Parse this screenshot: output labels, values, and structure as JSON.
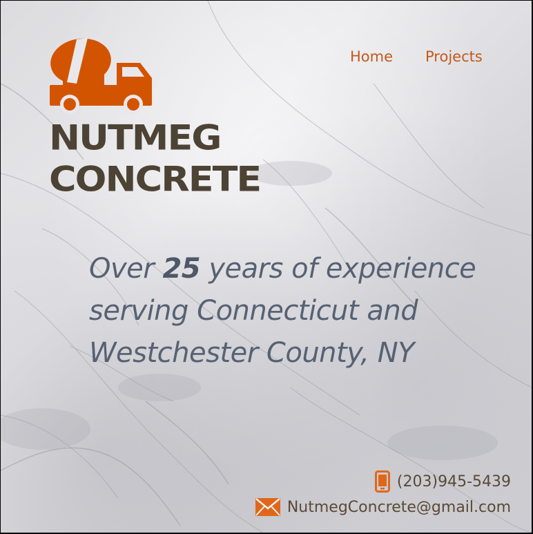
{
  "brand": {
    "name_line1": "NUTMEG",
    "name_line2": "CONCRETE",
    "logo_icon": "concrete-mixer-truck-icon",
    "accent_color": "#d35400",
    "text_color": "#4c4334"
  },
  "nav": {
    "items": [
      {
        "label": "Home"
      },
      {
        "label": "Projects"
      }
    ]
  },
  "hero": {
    "tagline_before": "Over ",
    "tagline_number": "25",
    "tagline_line1_rest": " years of experience",
    "tagline_line2": "serving Connecticut and",
    "tagline_line3": "Westchester County, NY"
  },
  "contact": {
    "phone": "(203)945-5439",
    "phone_icon": "mobile-phone-icon",
    "email": "NutmegConcrete@gmail.com",
    "email_icon": "envelope-icon"
  }
}
